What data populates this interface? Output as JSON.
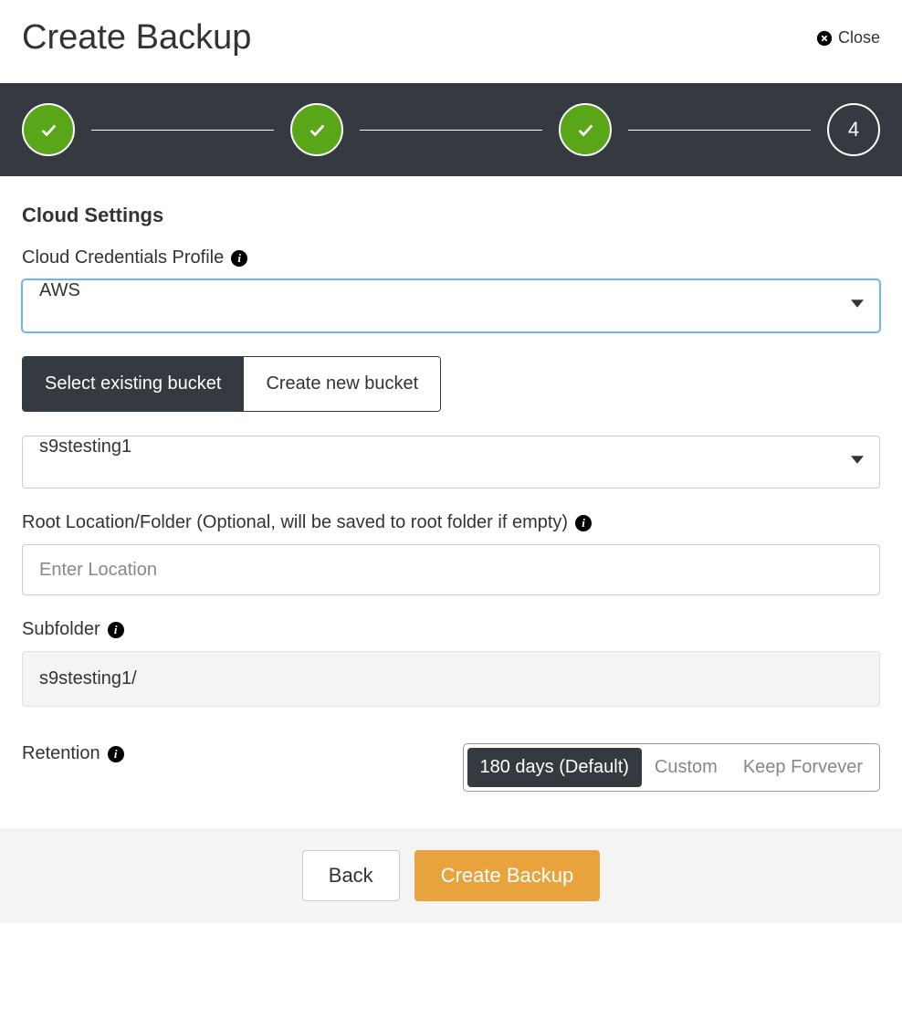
{
  "header": {
    "title": "Create Backup",
    "close_label": "Close"
  },
  "stepper": {
    "current_step": "4"
  },
  "section": {
    "title": "Cloud Settings"
  },
  "credentials": {
    "label": "Cloud Credentials Profile",
    "selected": "AWS"
  },
  "bucket_toggle": {
    "existing_label": "Select existing bucket",
    "create_label": "Create new bucket"
  },
  "bucket_select": {
    "selected": "s9stesting1"
  },
  "root_location": {
    "label": "Root Location/Folder (Optional, will be saved to root folder if empty)",
    "placeholder": "Enter Location",
    "value": ""
  },
  "subfolder": {
    "label": "Subfolder",
    "value": "s9stesting1/"
  },
  "retention": {
    "label": "Retention",
    "options": {
      "default": "180 days (Default)",
      "custom": "Custom",
      "forever": "Keep Forvever"
    }
  },
  "footer": {
    "back_label": "Back",
    "submit_label": "Create Backup"
  }
}
